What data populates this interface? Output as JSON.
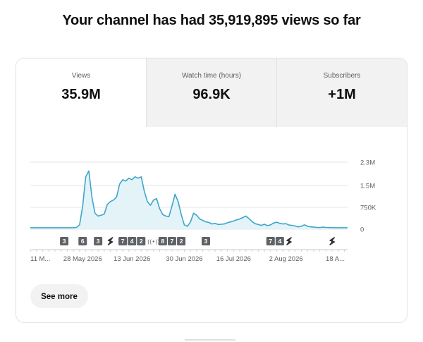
{
  "headline": "Your channel has had 35,919,895 views so far",
  "tabs": [
    {
      "label": "Views",
      "value": "35.9M",
      "active": true
    },
    {
      "label": "Watch time (hours)",
      "value": "96.9K",
      "active": false
    },
    {
      "label": "Subscribers",
      "value": "+1M",
      "active": false
    }
  ],
  "see_more_label": "See more",
  "chart_data": {
    "type": "area",
    "yticks": [
      "2.3M",
      "1.5M",
      "750K",
      "0"
    ],
    "yrange": [
      0,
      2300000
    ],
    "grid": true,
    "xticks": [
      "11 M...",
      "28 May 2026",
      "13 Jun 2026",
      "30 Jun 2026",
      "16 Jul 2026",
      "2 Aug 2026",
      "18 A..."
    ],
    "x": [
      "11 May",
      "12 May",
      "13 May",
      "14 May",
      "15 May",
      "16 May",
      "17 May",
      "18 May",
      "19 May",
      "20 May",
      "21 May",
      "22 May",
      "23 May",
      "24 May",
      "25 May",
      "26 May",
      "27 May",
      "28 May",
      "29 May",
      "30 May",
      "31 May",
      "1 Jun",
      "2 Jun",
      "3 Jun",
      "4 Jun",
      "5 Jun",
      "6 Jun",
      "7 Jun",
      "8 Jun",
      "9 Jun",
      "10 Jun",
      "11 Jun",
      "12 Jun",
      "13 Jun",
      "14 Jun",
      "15 Jun",
      "16 Jun",
      "17 Jun",
      "18 Jun",
      "19 Jun",
      "20 Jun",
      "21 Jun",
      "22 Jun",
      "23 Jun",
      "24 Jun",
      "25 Jun",
      "26 Jun",
      "27 Jun",
      "28 Jun",
      "29 Jun",
      "30 Jun",
      "1 Jul",
      "2 Jul",
      "3 Jul",
      "4 Jul",
      "5 Jul",
      "6 Jul",
      "7 Jul",
      "8 Jul",
      "9 Jul",
      "10 Jul",
      "11 Jul",
      "12 Jul",
      "13 Jul",
      "14 Jul",
      "15 Jul",
      "16 Jul",
      "17 Jul",
      "18 Jul",
      "19 Jul",
      "20 Jul",
      "21 Jul",
      "22 Jul",
      "23 Jul",
      "24 Jul",
      "25 Jul",
      "26 Jul",
      "27 Jul",
      "28 Jul",
      "29 Jul",
      "30 Jul",
      "31 Jul",
      "1 Aug",
      "2 Aug",
      "3 Aug",
      "4 Aug",
      "5 Aug",
      "6 Aug",
      "7 Aug",
      "8 Aug",
      "9 Aug",
      "10 Aug",
      "11 Aug",
      "12 Aug",
      "13 Aug",
      "14 Aug",
      "15 Aug",
      "16 Aug",
      "17 Aug",
      "18 Aug",
      "19 Aug",
      "20 Aug",
      "21 Aug"
    ],
    "values": [
      50000,
      50000,
      50000,
      50000,
      50000,
      50000,
      50000,
      50000,
      50000,
      50000,
      50000,
      50000,
      50000,
      50000,
      50000,
      60000,
      150000,
      800000,
      1800000,
      2000000,
      1100000,
      550000,
      450000,
      480000,
      520000,
      850000,
      950000,
      1000000,
      1100000,
      1550000,
      1700000,
      1650000,
      1750000,
      1700000,
      1800000,
      1750000,
      1800000,
      1300000,
      950000,
      820000,
      1000000,
      1050000,
      700000,
      500000,
      450000,
      430000,
      800000,
      1200000,
      950000,
      500000,
      150000,
      100000,
      250000,
      550000,
      480000,
      350000,
      300000,
      250000,
      230000,
      180000,
      200000,
      160000,
      170000,
      180000,
      220000,
      250000,
      280000,
      320000,
      350000,
      400000,
      450000,
      360000,
      260000,
      190000,
      160000,
      130000,
      170000,
      120000,
      150000,
      210000,
      240000,
      200000,
      180000,
      190000,
      140000,
      130000,
      110000,
      80000,
      100000,
      150000,
      100000,
      80000,
      70000,
      60000,
      55000,
      70000,
      60000,
      55000,
      50000,
      50000,
      50000,
      50000,
      50000,
      50000
    ],
    "markers": [
      {
        "x": "22 May",
        "label": "3"
      },
      {
        "x": "28 May",
        "label": "6"
      },
      {
        "x": "2 Jun",
        "label": "3"
      },
      {
        "x": "6 Jun",
        "label": "short-icon"
      },
      {
        "x": "10 Jun",
        "label": "7"
      },
      {
        "x": "13 Jun",
        "label": "4"
      },
      {
        "x": "16 Jun",
        "label": "2"
      },
      {
        "x": "20 Jun",
        "label": "live-icon"
      },
      {
        "x": "23 Jun",
        "label": "8"
      },
      {
        "x": "26 Jun",
        "label": "7"
      },
      {
        "x": "29 Jun",
        "label": "2"
      },
      {
        "x": "7 Jul",
        "label": "3"
      },
      {
        "x": "28 Jul",
        "label": "7"
      },
      {
        "x": "31 Jul",
        "label": "4"
      },
      {
        "x": "3 Aug",
        "label": "short-icon"
      },
      {
        "x": "17 Aug",
        "label": "short-icon"
      }
    ],
    "colors": {
      "line": "#3ea6c9",
      "fill": "#e3f3f8",
      "marker": "#5f6368",
      "grid": "#e5e5e5",
      "axis": "#909090"
    }
  }
}
